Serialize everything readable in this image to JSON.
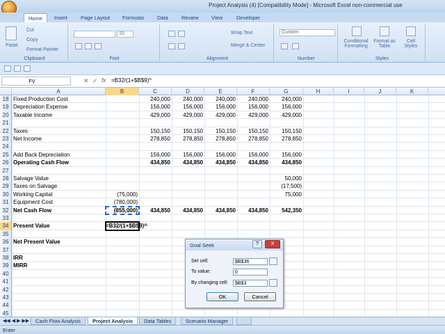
{
  "window": {
    "title": "Project Analysis (4)  [Compatibility Mode] - Microsoft Excel non-commercial use"
  },
  "ribbon": {
    "tabs": [
      "Home",
      "Insert",
      "Page Layout",
      "Formulas",
      "Data",
      "Review",
      "View",
      "Developer"
    ],
    "active_tab": "Home",
    "clipboard": {
      "paste": "Paste",
      "cut": "Cut",
      "copy": "Copy",
      "format_painter": "Format Painter",
      "label": "Clipboard"
    },
    "font": {
      "font_name": "",
      "font_size": "10",
      "label": "Font"
    },
    "alignment": {
      "wrap_text": "Wrap Text",
      "merge_center": "Merge & Center",
      "label": "Alignment"
    },
    "number": {
      "format": "Custom",
      "label": "Number"
    },
    "styles": {
      "conditional": "Conditional Formatting",
      "format_table": "Format as Table",
      "cell_styles": "Cell Styles",
      "label": "Styles"
    }
  },
  "formula_bar": {
    "name_box": "FV",
    "formula": "=B32/(1+$B$9)^"
  },
  "columns": [
    "A",
    "B",
    "C",
    "D",
    "E",
    "F",
    "G",
    "H",
    "I",
    "J",
    "K"
  ],
  "selected_column": "B",
  "rows": [
    {
      "num": "18",
      "a": "Fixed Production Cost",
      "b": "",
      "c": "240,000",
      "d": "240,000",
      "e": "240,000",
      "f": "240,000",
      "g": "240,000",
      "bold": false
    },
    {
      "num": "19",
      "a": "Depreciation Expense",
      "b": "",
      "c": "156,000",
      "d": "156,000",
      "e": "156,000",
      "f": "156,000",
      "g": "156,000",
      "bold": false
    },
    {
      "num": "20",
      "a": "Taxable Income",
      "b": "",
      "c": "429,000",
      "d": "429,000",
      "e": "429,000",
      "f": "429,000",
      "g": "429,000",
      "bold": false
    },
    {
      "num": "21",
      "a": "",
      "b": "",
      "c": "",
      "d": "",
      "e": "",
      "f": "",
      "g": "",
      "bold": false
    },
    {
      "num": "22",
      "a": "Taxes",
      "b": "",
      "c": "150,150",
      "d": "150,150",
      "e": "150,150",
      "f": "150,150",
      "g": "150,150",
      "bold": false
    },
    {
      "num": "23",
      "a": "Net Income",
      "b": "",
      "c": "278,850",
      "d": "278,850",
      "e": "278,850",
      "f": "278,850",
      "g": "278,850",
      "bold": false
    },
    {
      "num": "24",
      "a": "",
      "b": "",
      "c": "",
      "d": "",
      "e": "",
      "f": "",
      "g": "",
      "bold": false
    },
    {
      "num": "25",
      "a": "Add Back Depreciation",
      "b": "",
      "c": "156,000",
      "d": "156,000",
      "e": "156,000",
      "f": "156,000",
      "g": "156,000",
      "bold": false
    },
    {
      "num": "26",
      "a": "Operating Cash Flow",
      "b": "",
      "c": "434,850",
      "d": "434,850",
      "e": "434,850",
      "f": "434,850",
      "g": "434,850",
      "bold": true
    },
    {
      "num": "27",
      "a": "",
      "b": "",
      "c": "",
      "d": "",
      "e": "",
      "f": "",
      "g": "",
      "bold": false
    },
    {
      "num": "28",
      "a": "Salvage Value",
      "b": "",
      "c": "",
      "d": "",
      "e": "",
      "f": "",
      "g": "50,000",
      "bold": false
    },
    {
      "num": "29",
      "a": "Taxes on Salvage",
      "b": "",
      "c": "",
      "d": "",
      "e": "",
      "f": "",
      "g": "(17,500)",
      "bold": false
    },
    {
      "num": "30",
      "a": "Working Capital",
      "b": "(75,000)",
      "c": "",
      "d": "",
      "e": "",
      "f": "",
      "g": "75,000",
      "bold": false
    },
    {
      "num": "31",
      "a": "Equipment Cost",
      "b": "(780,000)",
      "c": "",
      "d": "",
      "e": "",
      "f": "",
      "g": "",
      "bold": false
    },
    {
      "num": "32",
      "a": "Net Cash Flow",
      "b": "(855,000)",
      "c": "434,850",
      "d": "434,850",
      "e": "434,850",
      "f": "434,850",
      "g": "542,350",
      "bold": true
    },
    {
      "num": "33",
      "a": "",
      "b": "",
      "c": "",
      "d": "",
      "e": "",
      "f": "",
      "g": "",
      "bold": false
    },
    {
      "num": "34",
      "a": "Present Value",
      "b": "=B32/(1+$B$9)^",
      "c": "",
      "d": "",
      "e": "",
      "f": "",
      "g": "",
      "bold": true
    },
    {
      "num": "35",
      "a": "",
      "b": "",
      "c": "",
      "d": "",
      "e": "",
      "f": "",
      "g": "",
      "bold": false
    },
    {
      "num": "36",
      "a": "Net Present Value",
      "b": "",
      "c": "",
      "d": "",
      "e": "",
      "f": "",
      "g": "",
      "bold": true
    },
    {
      "num": "37",
      "a": "",
      "b": "",
      "c": "",
      "d": "",
      "e": "",
      "f": "",
      "g": "",
      "bold": false
    },
    {
      "num": "38",
      "a": "IRR",
      "b": "",
      "c": "",
      "d": "",
      "e": "",
      "f": "",
      "g": "",
      "bold": true
    },
    {
      "num": "39",
      "a": "MIRR",
      "b": "",
      "c": "",
      "d": "",
      "e": "",
      "f": "",
      "g": "",
      "bold": true
    },
    {
      "num": "40",
      "a": "",
      "b": "",
      "c": "",
      "d": "",
      "e": "",
      "f": "",
      "g": "",
      "bold": false
    },
    {
      "num": "41",
      "a": "",
      "b": "",
      "c": "",
      "d": "",
      "e": "",
      "f": "",
      "g": "",
      "bold": false
    },
    {
      "num": "42",
      "a": "",
      "b": "",
      "c": "",
      "d": "",
      "e": "",
      "f": "",
      "g": "",
      "bold": false
    },
    {
      "num": "43",
      "a": "",
      "b": "",
      "c": "",
      "d": "",
      "e": "",
      "f": "",
      "g": "",
      "bold": false
    },
    {
      "num": "44",
      "a": "",
      "b": "",
      "c": "",
      "d": "",
      "e": "",
      "f": "",
      "g": "",
      "bold": false
    },
    {
      "num": "45",
      "a": "",
      "b": "",
      "c": "",
      "d": "",
      "e": "",
      "f": "",
      "g": "",
      "bold": false
    },
    {
      "num": "46",
      "a": "",
      "b": "",
      "c": "",
      "d": "",
      "e": "",
      "f": "",
      "g": "",
      "bold": false
    },
    {
      "num": "47",
      "a": "",
      "b": "",
      "c": "",
      "d": "",
      "e": "",
      "f": "",
      "g": "",
      "bold": false
    },
    {
      "num": "48",
      "a": "",
      "b": "",
      "c": "",
      "d": "",
      "e": "",
      "f": "",
      "g": "",
      "bold": false
    }
  ],
  "goal_seek": {
    "title": "Goal Seek",
    "set_cell_label": "Set cell:",
    "set_cell_value": "$B$36",
    "to_value_label": "To value:",
    "to_value_value": "0",
    "changing_label": "By changing cell:",
    "changing_value": "$B$3",
    "ok": "OK",
    "cancel": "Cancel",
    "help": "?",
    "close": "X"
  },
  "sheet_tabs": [
    "Cash Flow Analysis",
    "Project Analysis",
    "Data Tables",
    "Scenario Manager"
  ],
  "active_sheet": "Project Analysis",
  "status": "Enter",
  "colors": {
    "accent": "#15428b",
    "selection": "#f8d88c"
  }
}
